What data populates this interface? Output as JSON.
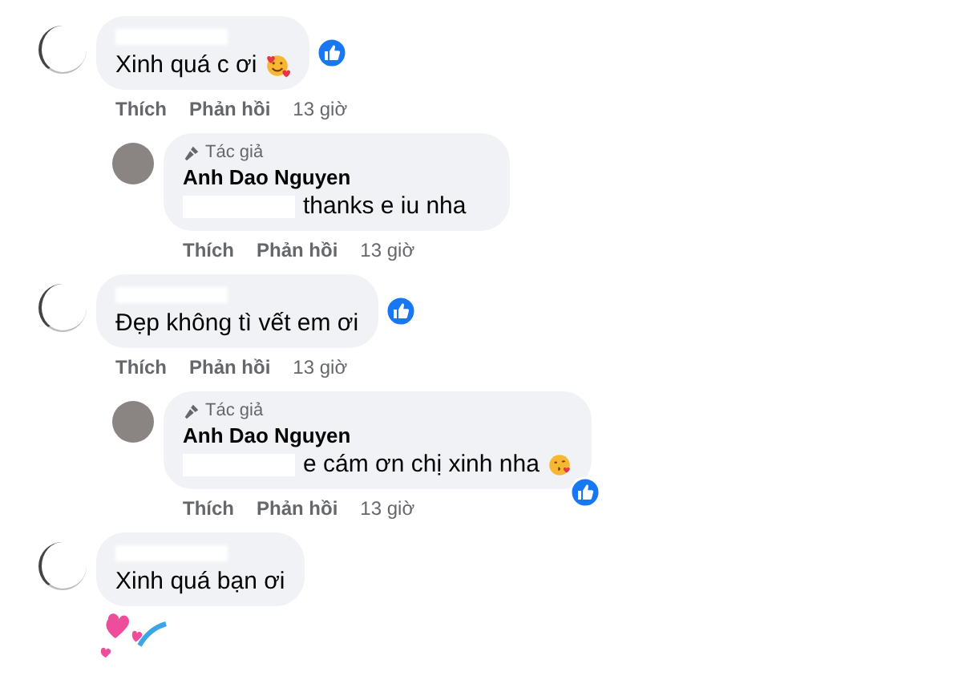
{
  "comments": [
    {
      "kind": "comment",
      "author_hidden": true,
      "text": "Xinh quá c ơi",
      "emoji": true,
      "liked": true,
      "actions": [
        "Thích",
        "Phản hồi"
      ],
      "time": "13 giờ"
    },
    {
      "kind": "reply",
      "badge": "Tác giả",
      "author": "Anh Dao Nguyen",
      "prefix_hidden": true,
      "text": "thanks e iu nha",
      "liked": false,
      "actions": [
        "Thích",
        "Phản hồi"
      ],
      "time": "13 giờ"
    },
    {
      "kind": "comment",
      "author_hidden": true,
      "text": "Đẹp không tì vết em ơi",
      "liked": true,
      "actions": [
        "Thích",
        "Phản hồi"
      ],
      "time": "13 giờ"
    },
    {
      "kind": "reply",
      "badge": "Tác giả",
      "author": "Anh Dao Nguyen",
      "prefix_hidden": true,
      "text": "e cám ơn chị xinh nha",
      "emoji": true,
      "liked": true,
      "actions": [
        "Thích",
        "Phản hồi"
      ],
      "time": "13 giờ"
    },
    {
      "kind": "comment",
      "author_hidden": true,
      "text": "Xinh quá bạn ơi",
      "liked": false,
      "sticker": true
    }
  ]
}
